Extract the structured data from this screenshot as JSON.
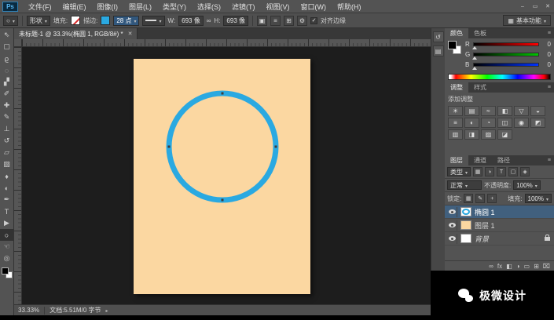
{
  "window": {
    "logo": "Ps",
    "controls": {
      "minimize": "–",
      "maximize": "▭",
      "close": "✕"
    }
  },
  "menu": {
    "items": [
      "文件(F)",
      "编辑(E)",
      "图像(I)",
      "图层(L)",
      "类型(Y)",
      "选择(S)",
      "滤镜(T)",
      "视图(V)",
      "窗口(W)",
      "帮助(H)"
    ]
  },
  "options_bar": {
    "tool_icon": "○",
    "mode_value": "形状",
    "fill_label": "填充:",
    "stroke_label": "描边:",
    "stroke_width": "28 点",
    "w_label": "W:",
    "w_value": "693 像",
    "h_label": "H:",
    "h_value": "693 像",
    "link_glyph": "∞",
    "op_icons": [
      {
        "name": "path-operations-icon",
        "glyph": "▣"
      },
      {
        "name": "path-alignment-icon",
        "glyph": "≡"
      },
      {
        "name": "path-arrange-icon",
        "glyph": "⊞"
      },
      {
        "name": "gear-icon",
        "glyph": "⚙"
      }
    ],
    "checkbox_glyph": "✓",
    "align_edges": "对齐边缘",
    "workspace_icon": "▦",
    "workspace": "基本功能"
  },
  "doc_tab": {
    "title": "未标题-1 @ 33.3%(椭圆 1, RGB/8#) *",
    "close_glyph": "✕"
  },
  "tools": [
    {
      "name": "move-tool",
      "glyph": "⇖"
    },
    {
      "name": "marquee-tool",
      "glyph": "▢"
    },
    {
      "name": "lasso-tool",
      "glyph": "ϱ"
    },
    {
      "name": "quick-selection-tool",
      "glyph": "◌"
    },
    {
      "name": "crop-tool",
      "glyph": "▞"
    },
    {
      "name": "eyedropper-tool",
      "glyph": "✐"
    },
    {
      "name": "healing-brush-tool",
      "glyph": "✚"
    },
    {
      "name": "brush-tool",
      "glyph": "✎"
    },
    {
      "name": "clone-stamp-tool",
      "glyph": "⊥"
    },
    {
      "name": "history-brush-tool",
      "glyph": "↺"
    },
    {
      "name": "eraser-tool",
      "glyph": "▱"
    },
    {
      "name": "gradient-tool",
      "glyph": "▨"
    },
    {
      "name": "blur-tool",
      "glyph": "♦"
    },
    {
      "name": "dodge-tool",
      "glyph": "◐"
    },
    {
      "name": "pen-tool",
      "glyph": "✒"
    },
    {
      "name": "type-tool",
      "glyph": "T"
    },
    {
      "name": "path-selection-tool",
      "glyph": "▶"
    },
    {
      "name": "ellipse-tool",
      "glyph": "○"
    },
    {
      "name": "hand-tool",
      "glyph": "☜"
    },
    {
      "name": "zoom-tool",
      "glyph": "◎"
    }
  ],
  "canvas": {
    "doc_color": "#fbd7a1",
    "circle_stroke": "#2aa9e1"
  },
  "dock_icons": [
    {
      "name": "history-panel-icon",
      "glyph": "↺"
    },
    {
      "name": "properties-panel-icon",
      "glyph": "▤"
    }
  ],
  "panels": {
    "menu_glyph": "≡",
    "color": {
      "tabs": [
        "颜色",
        "色板"
      ],
      "foreground": "#000000",
      "background": "#ffffff",
      "channels": [
        {
          "label": "R",
          "value": "0"
        },
        {
          "label": "G",
          "value": "0"
        },
        {
          "label": "B",
          "value": "0"
        }
      ]
    },
    "adjustments": {
      "tabs": [
        "调整",
        "样式"
      ],
      "title": "添加调整",
      "icons": [
        {
          "name": "brightness-contrast-icon",
          "glyph": "☀"
        },
        {
          "name": "levels-icon",
          "glyph": "▤"
        },
        {
          "name": "curves-icon",
          "glyph": "≈"
        },
        {
          "name": "exposure-icon",
          "glyph": "◧"
        },
        {
          "name": "vibrance-icon",
          "glyph": "▽"
        },
        {
          "name": "hue-saturation-icon",
          "glyph": "◒"
        },
        {
          "name": "color-balance-icon",
          "glyph": "≡"
        },
        {
          "name": "black-white-icon",
          "glyph": "◐"
        },
        {
          "name": "photo-filter-icon",
          "glyph": "◔"
        },
        {
          "name": "channel-mixer-icon",
          "glyph": "◫"
        },
        {
          "name": "color-lookup-icon",
          "glyph": "◉"
        },
        {
          "name": "invert-icon",
          "glyph": "◩"
        },
        {
          "name": "posterize-icon",
          "glyph": "▥"
        },
        {
          "name": "threshold-icon",
          "glyph": "◨"
        },
        {
          "name": "gradient-map-icon",
          "glyph": "▨"
        },
        {
          "name": "selective-color-icon",
          "glyph": "◪"
        }
      ]
    },
    "layers": {
      "tabs": [
        "图层",
        "通道",
        "路径"
      ],
      "filter_label": "类型",
      "filter_icons": [
        {
          "name": "pixel-filter-icon",
          "glyph": "▦"
        },
        {
          "name": "adjustment-filter-icon",
          "glyph": "◑"
        },
        {
          "name": "type-filter-icon",
          "glyph": "T"
        },
        {
          "name": "shape-filter-icon",
          "glyph": "▢"
        },
        {
          "name": "smart-object-filter-icon",
          "glyph": "◈"
        }
      ],
      "blend_mode": "正常",
      "opacity_label": "不透明度:",
      "opacity_value": "100%",
      "lock_label": "锁定:",
      "lock_icons": [
        {
          "name": "lock-transparency-icon",
          "glyph": "▦"
        },
        {
          "name": "lock-pixels-icon",
          "glyph": "✎"
        },
        {
          "name": "lock-position-icon",
          "glyph": "+"
        }
      ],
      "fill_label": "填充:",
      "fill_value": "100%",
      "items": [
        {
          "name": "椭圆 1"
        },
        {
          "name": "图层 1"
        },
        {
          "name": "背景"
        }
      ],
      "footer_icons": [
        {
          "name": "link-layers-icon",
          "glyph": "∞"
        },
        {
          "name": "layer-style-icon",
          "glyph": "fx"
        },
        {
          "name": "layer-mask-icon",
          "glyph": "◧"
        },
        {
          "name": "adjustment-layer-icon",
          "glyph": "◑"
        },
        {
          "name": "new-group-icon",
          "glyph": "▭"
        },
        {
          "name": "new-layer-icon",
          "glyph": "⊞"
        },
        {
          "name": "delete-layer-icon",
          "glyph": "⌧"
        }
      ]
    }
  },
  "status_bar": {
    "zoom": "33.33%",
    "doc_info": "文档:5.51M/0 字节"
  },
  "watermark": {
    "text": "极微设计"
  }
}
